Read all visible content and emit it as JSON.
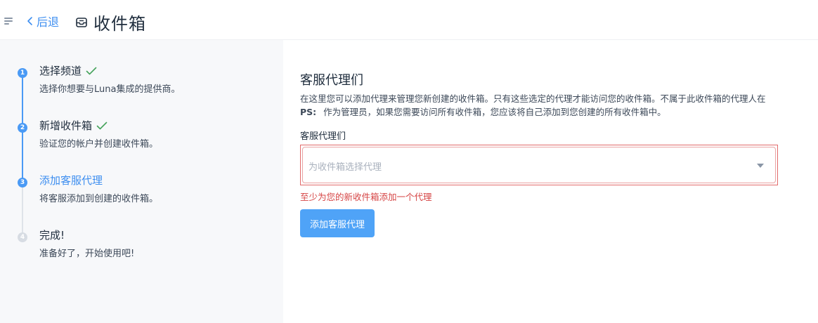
{
  "header": {
    "back_label": "后退",
    "title": "收件箱"
  },
  "steps": [
    {
      "number": "1",
      "title": "选择频道",
      "description": "选择你想要与Luna集成的提供商。",
      "state": "complete"
    },
    {
      "number": "2",
      "title": "新增收件箱",
      "description": "验证您的帐户并创建收件箱。",
      "state": "complete"
    },
    {
      "number": "3",
      "title": "添加客服代理",
      "description": "将客服添加到创建的收件箱。",
      "state": "active"
    },
    {
      "number": "4",
      "title": "完成!",
      "description": "准备好了，开始使用吧!",
      "state": "pending"
    }
  ],
  "form": {
    "title": "客服代理们",
    "description": "在这里您可以添加代理来管理您新创建的收件箱。只有这些选定的代理才能访问您的收件箱。不属于此收件箱的代理人在",
    "ps_label": "PS:",
    "ps_text": "作为管理员，如果您需要访问所有收件箱，您应该将自己添加到您创建的所有收件箱中。",
    "field_label": "客服代理们",
    "select_placeholder": "为收件箱选择代理",
    "error": "至少为您的新收件箱添加一个代理",
    "submit_label": "添加客服代理"
  },
  "colors": {
    "accent": "#3d8ef0",
    "step_complete": "#4a9af5",
    "step_pending": "#d7dce3",
    "check": "#45a35b",
    "error": "#d64545",
    "button": "#4fa3f7"
  },
  "icons": {
    "menu": "menu-icon",
    "back": "chevron-left-icon",
    "inbox": "inbox-icon",
    "check": "check-icon",
    "dropdown": "caret-down-icon"
  }
}
